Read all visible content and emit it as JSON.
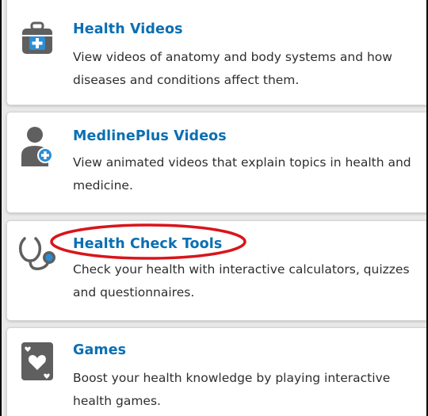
{
  "cards": [
    {
      "title": "Health Videos",
      "description": "View videos of anatomy and body systems and how diseases and conditions affect them.",
      "icon": "medical-kit-icon"
    },
    {
      "title": "MedlinePlus Videos",
      "description": "View animated videos that explain topics in health and medicine.",
      "icon": "person-plus-icon"
    },
    {
      "title": "Health Check Tools",
      "description": "Check your health with interactive calculators, quizzes and questionnaires.",
      "icon": "stethoscope-icon"
    },
    {
      "title": "Games",
      "description": "Boost your health knowledge by playing interactive health games.",
      "icon": "heart-card-icon"
    }
  ],
  "colors": {
    "link": "#0b6fb3",
    "text": "#2e2e2e",
    "icon_gray": "#5f5f5f",
    "icon_blue": "#2a8ed6",
    "annotation_red": "#d8151b"
  }
}
